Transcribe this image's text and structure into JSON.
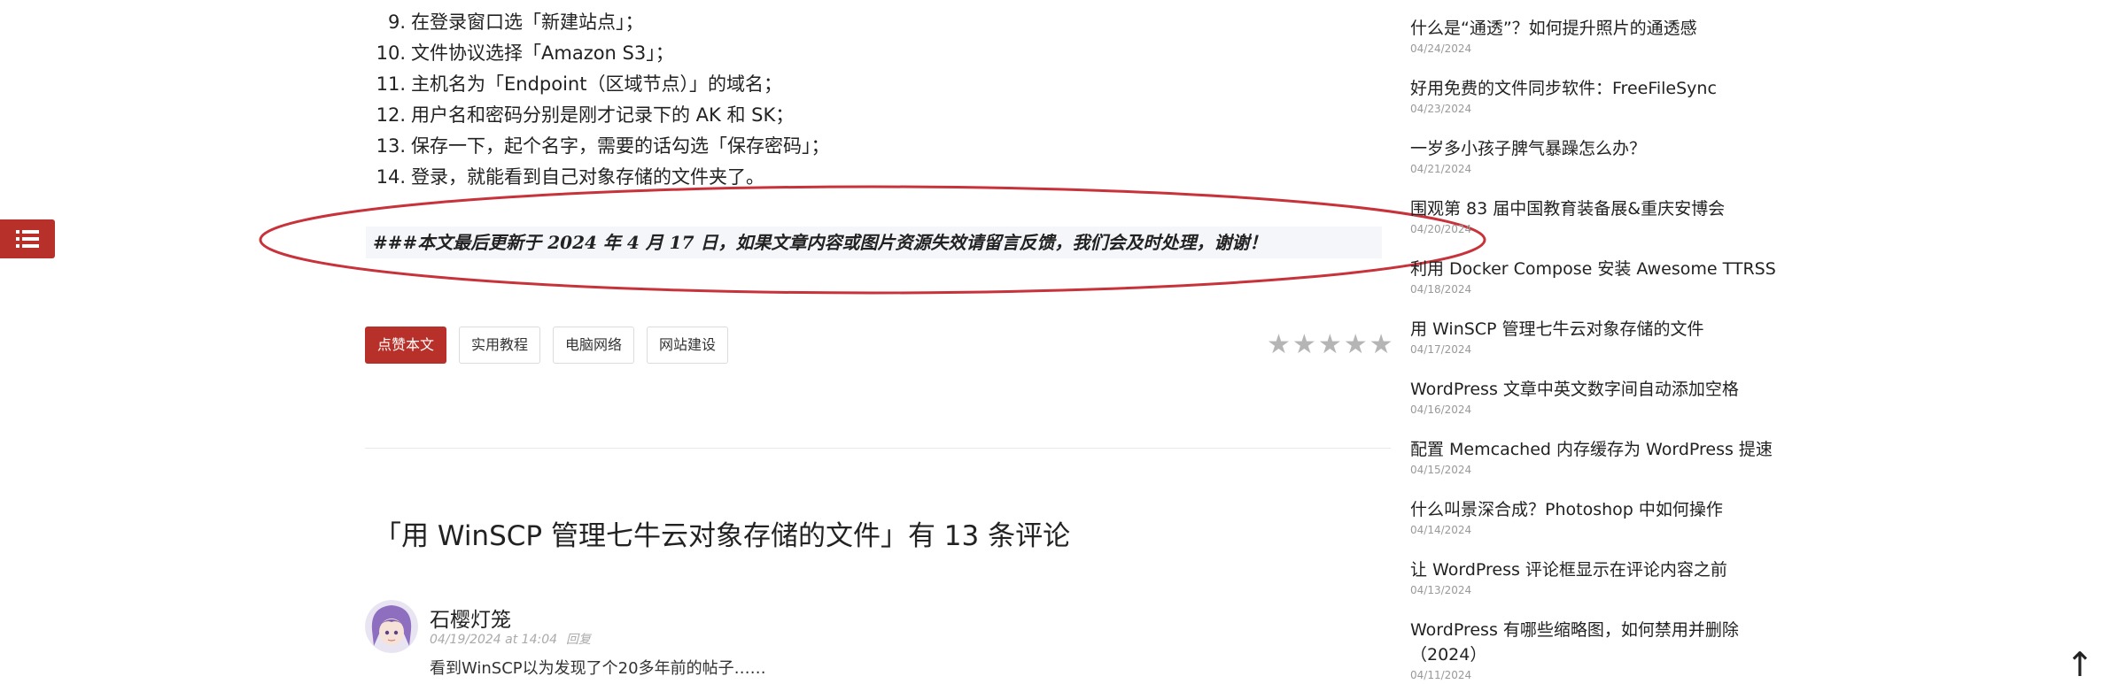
{
  "toc_button": {
    "icon": "list-icon"
  },
  "article": {
    "steps": [
      {
        "num": "9.",
        "text": "在登录窗口选「新建站点」；"
      },
      {
        "num": "10.",
        "text": "文件协议选择「Amazon S3」；"
      },
      {
        "num": "11.",
        "text": "主机名为「Endpoint（区域节点）」的域名；"
      },
      {
        "num": "12.",
        "text": "用户名和密码分别是刚才记录下的 AK 和 SK；"
      },
      {
        "num": "13.",
        "text": "保存一下，起个名字，需要的话勾选「保存密码」；"
      },
      {
        "num": "14.",
        "text": "登录，就能看到自己对象存储的文件夹了。"
      }
    ],
    "update_note": "###本文最后更新于 2024 年 4 月 17 日，如果文章内容或图片资源失效请留言反馈，我们会及时处理，谢谢！",
    "annotation_color": "#c8323a",
    "like_label": "点赞本文",
    "tags": [
      "实用教程",
      "电脑网络",
      "网站建设"
    ],
    "rating_stars": 5
  },
  "comments": {
    "title": "「用 WinSCP 管理七牛云对象存储的文件」有 13 条评论",
    "items": [
      {
        "author": "石樱灯笼",
        "date": "04/19/2024 at 14:04",
        "reply_label": "回复",
        "text": "看到WinSCP以为发现了个20多年前的帖子……"
      }
    ]
  },
  "sidebar": {
    "posts": [
      {
        "title": "什么是“通透”？如何提升照片的通透感",
        "date": "04/24/2024"
      },
      {
        "title": "好用免费的文件同步软件：FreeFileSync",
        "date": "04/23/2024"
      },
      {
        "title": "一岁多小孩子脾气暴躁怎么办？",
        "date": "04/21/2024"
      },
      {
        "title": "围观第 83 届中国教育装备展&重庆安博会",
        "date": "04/20/2024"
      },
      {
        "title": "利用 Docker Compose 安装 Awesome TTRSS",
        "date": "04/18/2024"
      },
      {
        "title": "用 WinSCP 管理七牛云对象存储的文件",
        "date": "04/17/2024"
      },
      {
        "title": "WordPress 文章中英文数字间自动添加空格",
        "date": "04/16/2024"
      },
      {
        "title": "配置 Memcached 内存缓存为 WordPress 提速",
        "date": "04/15/2024"
      },
      {
        "title": "什么叫景深合成？Photoshop 中如何操作",
        "date": "04/14/2024"
      },
      {
        "title": "让 WordPress 评论框显示在评论内容之前",
        "date": "04/13/2024"
      },
      {
        "title": "WordPress 有哪些缩略图，如何禁用并删除（2024）",
        "date": "04/11/2024"
      }
    ]
  },
  "back_to_top": {
    "label": "↑"
  },
  "colors": {
    "accent": "#b8302a",
    "text": "#222222",
    "muted": "#999999"
  }
}
